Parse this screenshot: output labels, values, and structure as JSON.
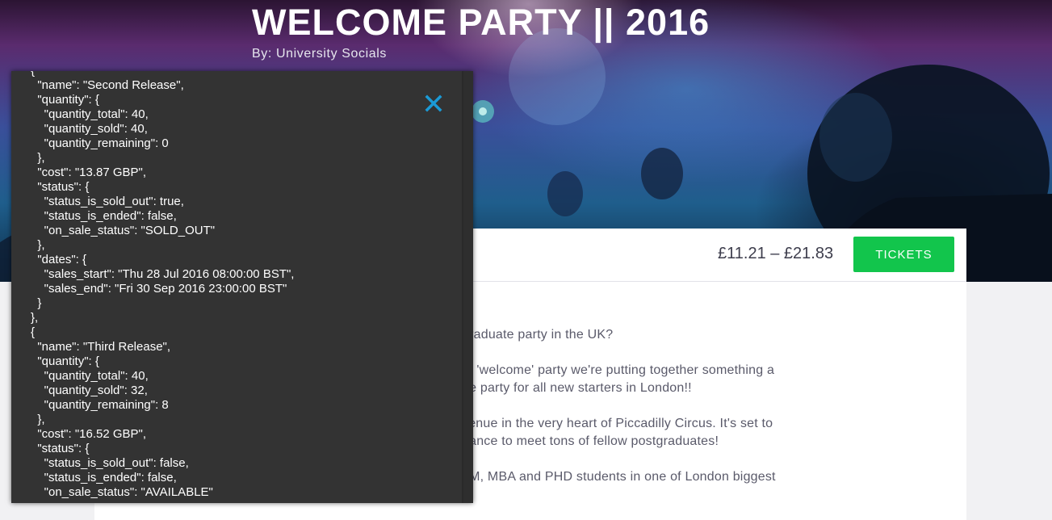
{
  "event": {
    "title": "WELCOME PARTY || 2016",
    "organizer": "By: University Socials",
    "price_range": "£11.21 – £21.83",
    "tickets_label": "TICKETS"
  },
  "description": [
    "graduate party in the UK?",
    "nt 'welcome' party we're putting together something a",
    "ge party for all new starters in London!!",
    "venue in the very heart of Piccadilly Circus. It's set to",
    "hance to meet tons of fellow postgraduates!",
    "LM, MBA and PHD students in one of London biggest"
  ],
  "overlay": {
    "close_icon": "close-x-icon",
    "accent_color": "#1a9ad6",
    "json_lines": [
      "{",
      "  \"name\": \"Second Release\",",
      "  \"quantity\": {",
      "    \"quantity_total\": 40,",
      "    \"quantity_sold\": 40,",
      "    \"quantity_remaining\": 0",
      "  },",
      "  \"cost\": \"13.87 GBP\",",
      "  \"status\": {",
      "    \"status_is_sold_out\": true,",
      "    \"status_is_ended\": false,",
      "    \"on_sale_status\": \"SOLD_OUT\"",
      "  },",
      "  \"dates\": {",
      "    \"sales_start\": \"Thu 28 Jul 2016 08:00:00 BST\",",
      "    \"sales_end\": \"Fri 30 Sep 2016 23:00:00 BST\"",
      "  }",
      "},",
      "{",
      "  \"name\": \"Third Release\",",
      "  \"quantity\": {",
      "    \"quantity_total\": 40,",
      "    \"quantity_sold\": 32,",
      "    \"quantity_remaining\": 8",
      "  },",
      "  \"cost\": \"16.52 GBP\",",
      "  \"status\": {",
      "    \"status_is_sold_out\": false,",
      "    \"status_is_ended\": false,",
      "    \"on_sale_status\": \"AVAILABLE\""
    ]
  },
  "colors": {
    "tickets_button": "#12c54c",
    "overlay_bg": "#333333"
  }
}
